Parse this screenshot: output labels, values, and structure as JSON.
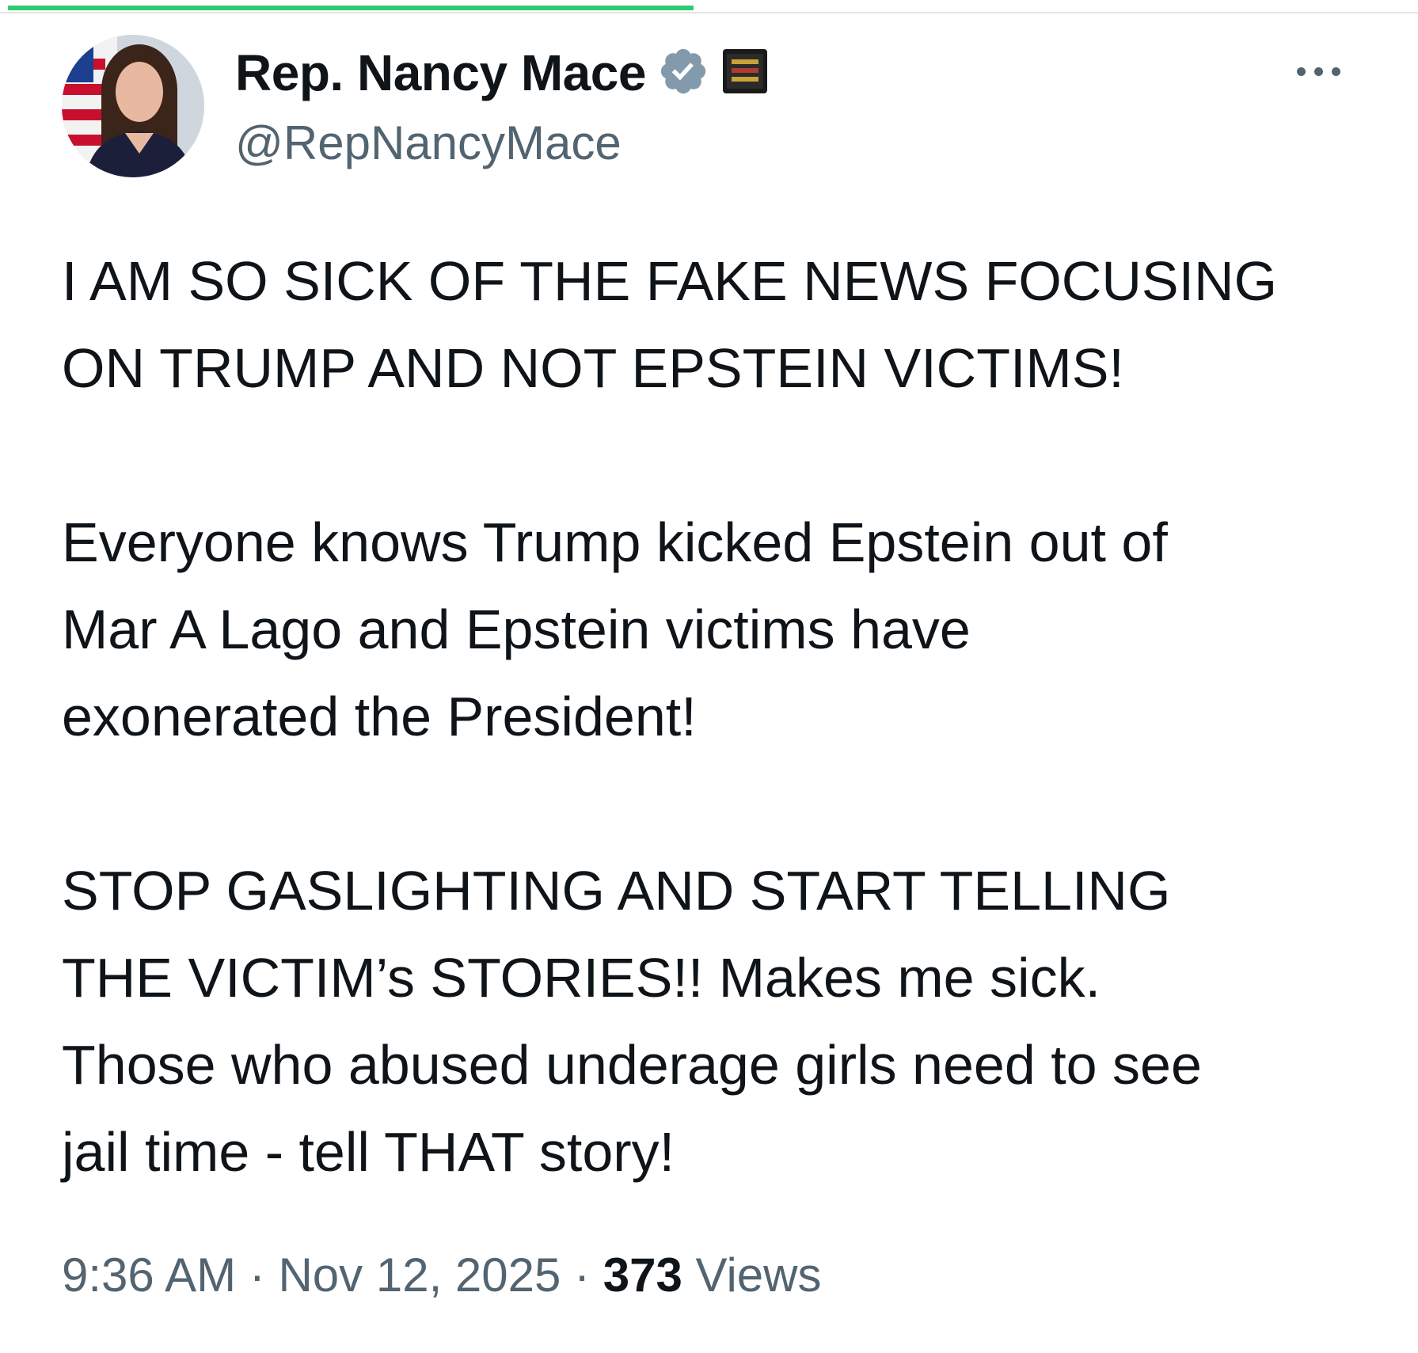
{
  "tweet": {
    "display_name": "Rep. Nancy Mace",
    "handle": "@RepNancyMace",
    "verified_icon": "verified-badge-icon",
    "affiliate_icon": "affiliate-badge-icon",
    "more_icon": "more-options-icon",
    "paragraphs": [
      [
        "I AM SO SICK OF THE FAKE NEWS FOCUSING",
        "ON TRUMP AND NOT EPSTEIN VICTIMS!"
      ],
      [
        "Everyone knows Trump kicked Epstein out of",
        "Mar A Lago and Epstein victims have",
        "exonerated the President!"
      ],
      [
        "STOP GASLIGHTING AND START TELLING",
        "THE VICTIM’s STORIES!! Makes me sick.",
        "Those who abused underage girls need to see",
        "jail time - tell THAT story!"
      ]
    ],
    "time": "9:36 AM",
    "separator": "·",
    "date": "Nov 12, 2025",
    "views_count": "373",
    "views_label": "Views"
  },
  "colors": {
    "progress": "#2ecc71",
    "text_primary": "#0f1419",
    "text_secondary": "#536471",
    "verified": "#829aab"
  }
}
